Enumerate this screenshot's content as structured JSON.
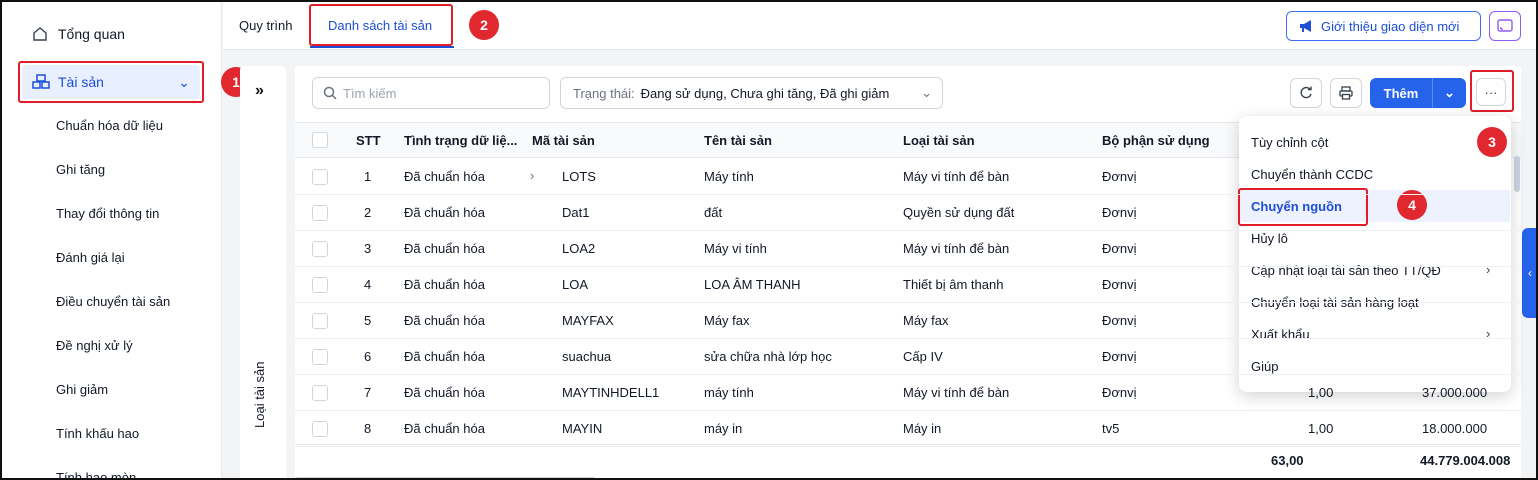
{
  "sidebar": {
    "overview": "Tổng quan",
    "active_item": "Tài sản",
    "sub_items": [
      "Chuẩn hóa dữ liệu",
      "Ghi tăng",
      "Thay đổi thông tin",
      "Đánh giá lại",
      "Điều chuyển tài sản",
      "Đề nghị xử lý",
      "Ghi giảm",
      "Tính khấu hao",
      "Tính hao mòn"
    ]
  },
  "tabs": {
    "process": "Quy trình",
    "asset_list": "Danh sách tài sản"
  },
  "header": {
    "intro_button": "Giới thiệu giao diện mới"
  },
  "annotations": [
    "1",
    "2",
    "3",
    "4"
  ],
  "toolbar": {
    "search_placeholder": "Tìm kiếm",
    "filter_label": "Trạng thái:",
    "filter_value": "Đang sử dụng, Chưa ghi tăng, Đã ghi giảm",
    "add_button": "Thêm"
  },
  "left_panel": {
    "label": "Loại tài sản"
  },
  "table": {
    "columns": [
      "STT",
      "Tình trạng dữ liệ...",
      "Mã tài sản",
      "Tên tài sản",
      "Loại tài sản",
      "Bộ phận sử dụng"
    ],
    "rows": [
      {
        "stt": "1",
        "status": "Đã chuẩn hóa",
        "code": "LOTS",
        "name": "Máy tính",
        "type": "Máy vi tính để bàn",
        "dept": "Đơnvị",
        "qty": "",
        "amount": ""
      },
      {
        "stt": "2",
        "status": "Đã chuẩn hóa",
        "code": "Dat1",
        "name": "đất",
        "type": "Quyền sử dụng đất",
        "dept": "Đơnvị",
        "qty": "",
        "amount": ""
      },
      {
        "stt": "3",
        "status": "Đã chuẩn hóa",
        "code": "LOA2",
        "name": "Máy vi tính",
        "type": "Máy vi tính để bàn",
        "dept": "Đơnvị",
        "qty": "",
        "amount": ""
      },
      {
        "stt": "4",
        "status": "Đã chuẩn hóa",
        "code": "LOA",
        "name": "LOA ÂM THANH",
        "type": "Thiết bị âm thanh",
        "dept": "Đơnvị",
        "qty": "",
        "amount": ""
      },
      {
        "stt": "5",
        "status": "Đã chuẩn hóa",
        "code": "MAYFAX",
        "name": "Máy fax",
        "type": "Máy fax",
        "dept": "Đơnvị",
        "qty": "",
        "amount": ""
      },
      {
        "stt": "6",
        "status": "Đã chuẩn hóa",
        "code": "suachua",
        "name": "sửa chữa nhà lớp học",
        "type": "Cấp IV",
        "dept": "Đơnvị",
        "qty": "",
        "amount": ""
      },
      {
        "stt": "7",
        "status": "Đã chuẩn hóa",
        "code": "MAYTINHDELL1",
        "name": "máy tính",
        "type": "Máy vi tính để bàn",
        "dept": "Đơnvị",
        "qty": "1,00",
        "amount": "37.000.000"
      },
      {
        "stt": "8",
        "status": "Đã chuẩn hóa",
        "code": "MAYIN",
        "name": "máy in",
        "type": "Máy in",
        "dept": "tv5",
        "qty": "1,00",
        "amount": "18.000.000"
      }
    ],
    "totals": {
      "qty": "63,00",
      "amount": "44.779.004.008"
    }
  },
  "menu": {
    "items": [
      "Tùy chỉnh cột",
      "Chuyển thành CCDC",
      "Chuyển nguồn",
      "Hủy lô",
      "Cập nhật loại tài sản theo TT/QĐ",
      "Chuyển loại tài sản hàng loạt",
      "Xuất khẩu",
      "Giúp"
    ]
  },
  "colors": {
    "accent": "#2563eb",
    "annotation": "#e0282e",
    "highlight_border": "#e11d2a"
  }
}
